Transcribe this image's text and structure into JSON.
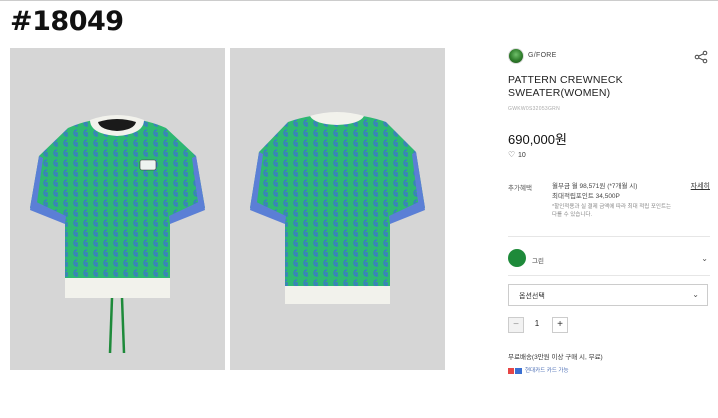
{
  "post": {
    "id": "#18049"
  },
  "gallery": {
    "images": [
      {
        "alt": "front",
        "icon": "sweater-front-image"
      },
      {
        "alt": "back",
        "icon": "sweater-back-image"
      }
    ]
  },
  "product": {
    "brand": "G/FORE",
    "title": "PATTERN CREWNECK SWEATER(WOMEN)",
    "sku": "GWKW0S32053GRN",
    "price": "690,000원",
    "likes": "10"
  },
  "benefits": {
    "label": "추가혜택",
    "line1": "월부금 월 98,571원 (*7개월 시)",
    "line2": "최대적립포인트 34,500P",
    "note": "*할인적용과 실 결제 금액에 따라 최대 적립 포인트는 다를 수 있습니다.",
    "detail": "자세히"
  },
  "options": {
    "color_name": "그린",
    "select_label": "옵션선택",
    "quantity": "1"
  },
  "shipping": {
    "text": "무료배송(3만원 이상 구매 시, 무료)",
    "pay": "현대카드 카드 가능"
  },
  "colors": {
    "swatch": "#1e8a3a",
    "knit": "#2eb872",
    "trim": "#f2f2ec",
    "sleeve": "#5b7fd6"
  }
}
